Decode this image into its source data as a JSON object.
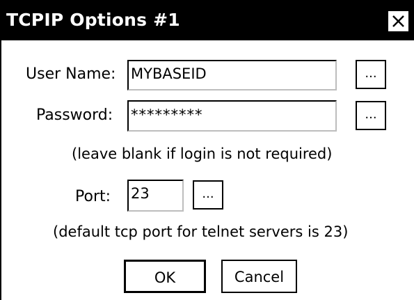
{
  "dialog": {
    "title": "TCPIP Options #1",
    "close_glyph": "✕"
  },
  "fields": {
    "user_name_label": "User Name:",
    "user_name_value": "MYBASEID",
    "password_label": "Password:",
    "password_value": "*********",
    "login_note": "(leave blank if login is not required)",
    "port_label": "Port:",
    "port_value": "23",
    "port_note": "(default tcp port for telnet servers is 23)"
  },
  "buttons": {
    "browse_label": "...",
    "ok_label": "OK",
    "cancel_label": "Cancel"
  },
  "icons": {
    "close": "close-icon"
  }
}
